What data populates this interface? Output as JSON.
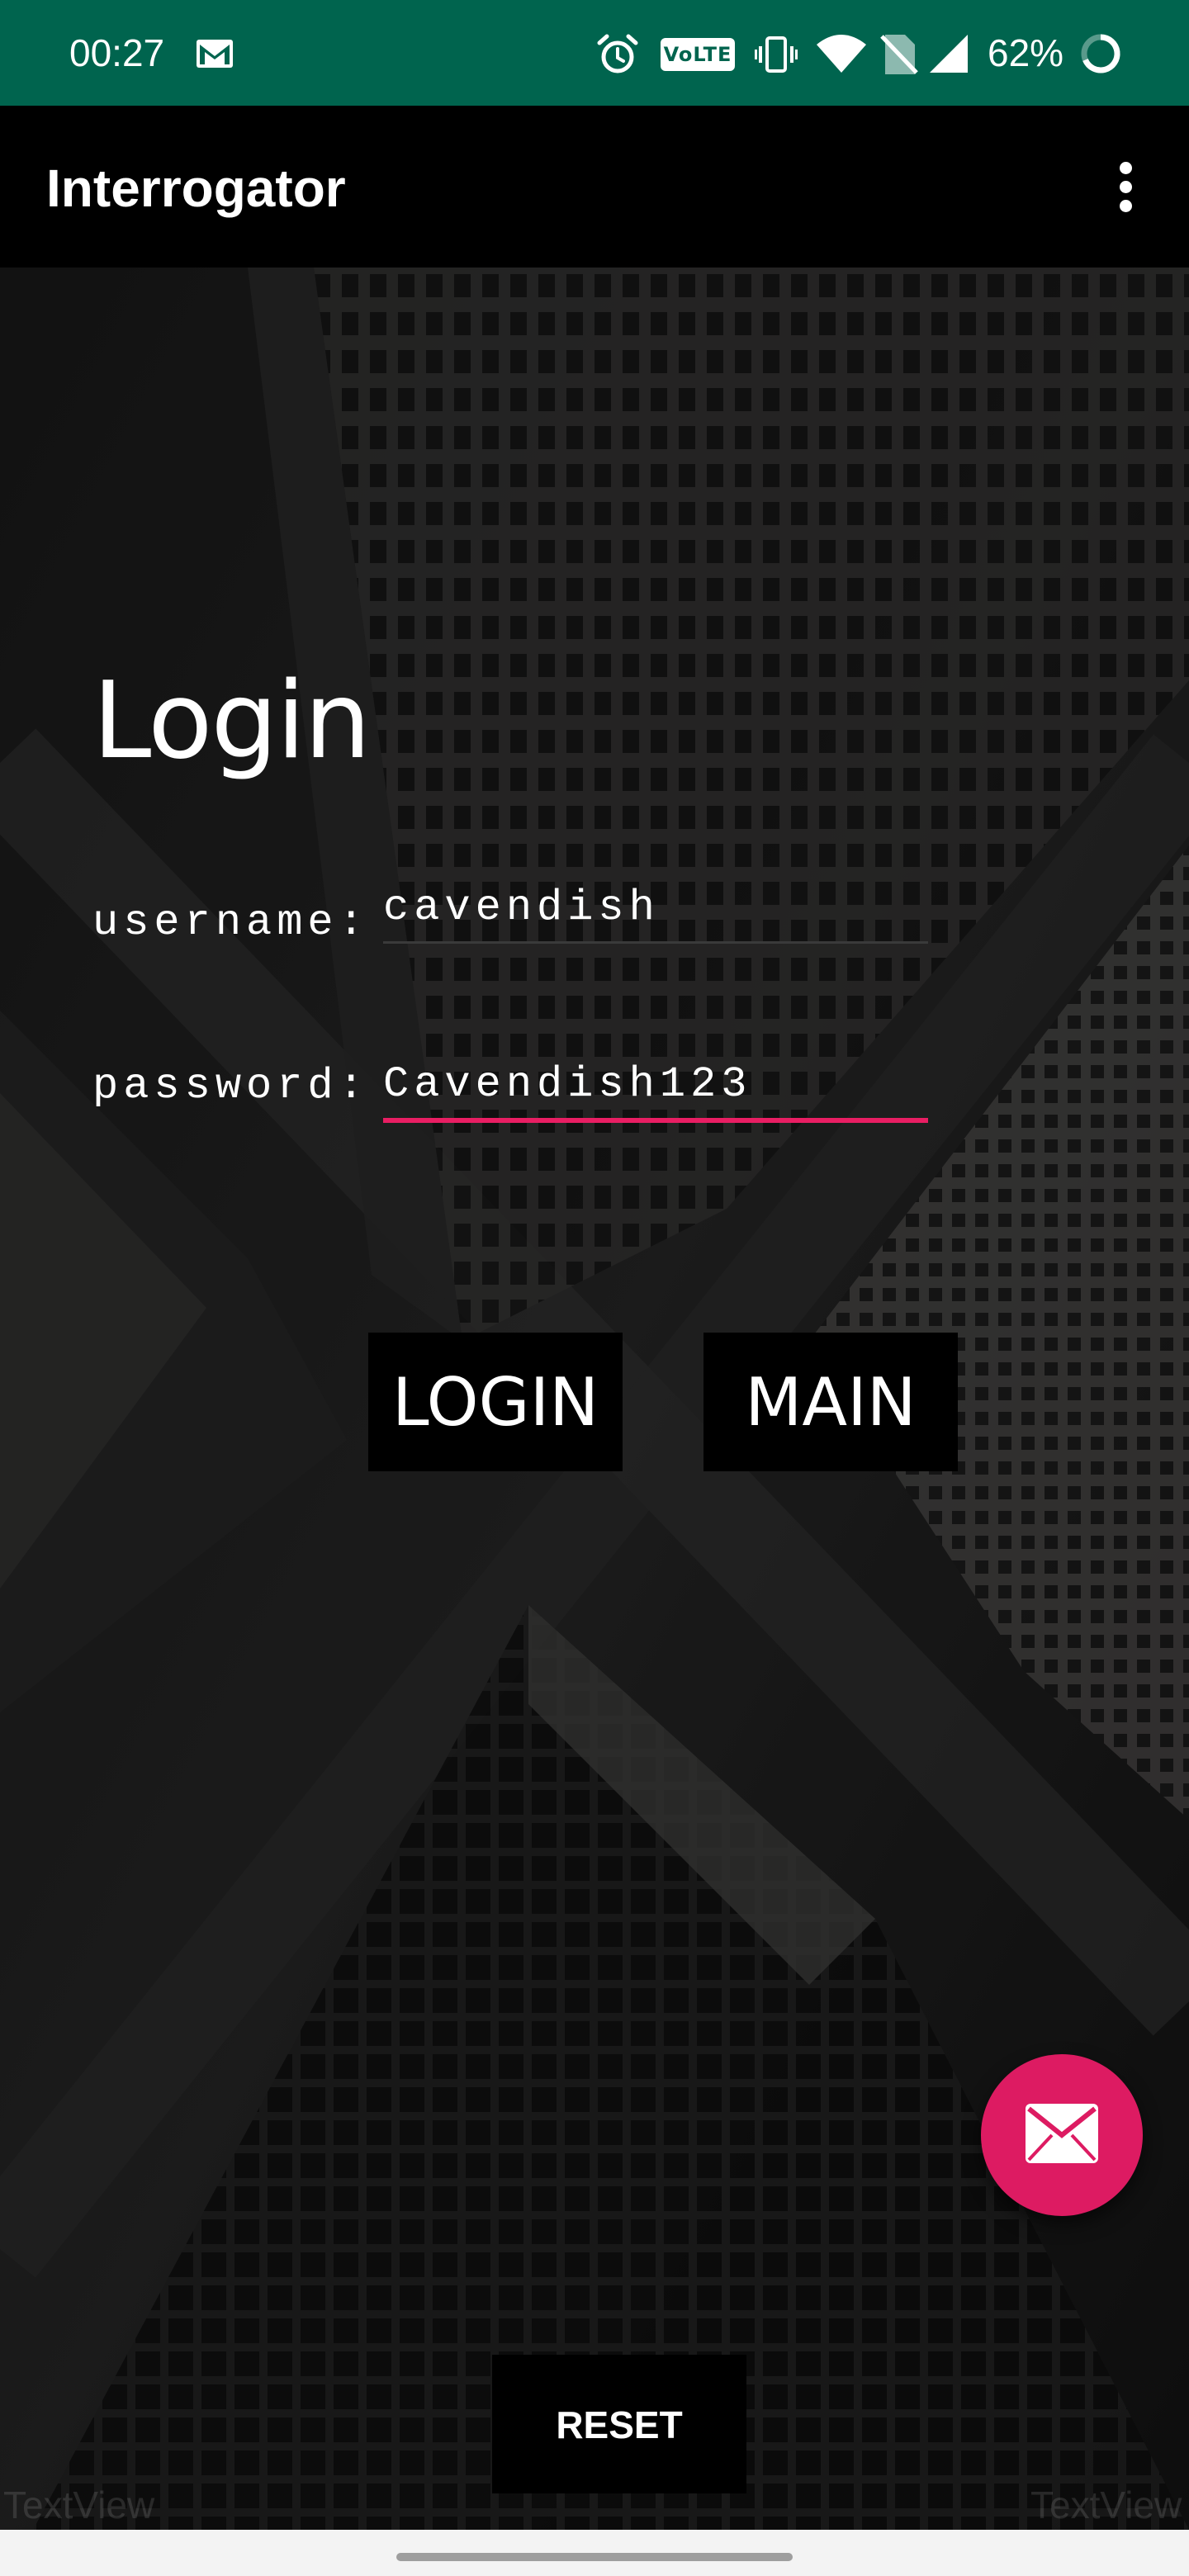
{
  "status_bar": {
    "time": "00:27",
    "battery_percent": "62%",
    "volte_label": "VoLTE",
    "icons": [
      "gmail-icon",
      "alarm-icon",
      "volte-icon",
      "vibrate-icon",
      "wifi-icon",
      "no-sim-icon",
      "signal-icon",
      "battery-icon"
    ]
  },
  "app_bar": {
    "title": "Interrogator",
    "menu_icon": "overflow-menu-icon"
  },
  "login": {
    "heading": "Login",
    "username_label": "username:",
    "username_value": "cavendish",
    "password_label": "password:",
    "password_value": "Cavendish123"
  },
  "buttons": {
    "login_label": "LOGIN",
    "main_label": "MAIN",
    "reset_label": "RESET"
  },
  "placeholders": {
    "left_textview": "TextView",
    "right_textview": "TextView"
  },
  "fab": {
    "icon": "email-icon"
  },
  "colors": {
    "status_bar": "#00644e",
    "accent": "#e91e63",
    "fab": "#dd1b62",
    "app_bar": "#000000"
  }
}
